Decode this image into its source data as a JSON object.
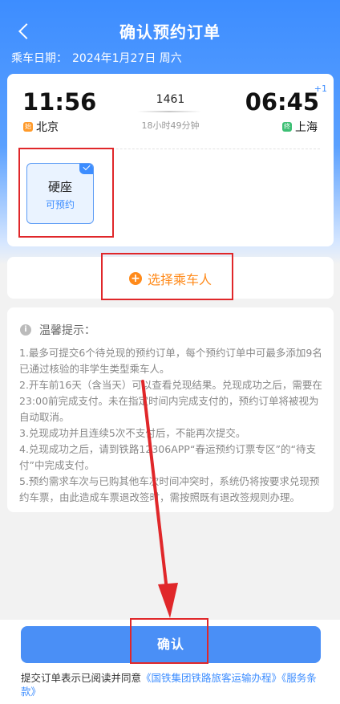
{
  "header": {
    "title": "确认预约订单",
    "date_label": "乘车日期：",
    "date_value": "2024年1月27日 周六"
  },
  "trip": {
    "departure_time": "11:56",
    "departure_station": "北京",
    "departure_badge": "始",
    "train_number": "1461",
    "duration": "18小时49分钟",
    "arrival_time": "06:45",
    "arrival_day_offset": "+1",
    "arrival_station": "上海",
    "arrival_badge": "终"
  },
  "seat": {
    "name": "硬座",
    "status": "可预约"
  },
  "passenger": {
    "select_label": "选择乘车人"
  },
  "tips": {
    "title": "温馨提示：",
    "lines": [
      "1.最多可提交6个待兑现的预约订单，每个预约订单中可最多添加9名已通过核验的非学生类型乘车人。",
      "2.开车前16天（含当天）可以查看兑现结果。兑现成功之后，需要在23:00前完成支付。未在指定时间内完成支付的，预约订单将被视为自动取消。",
      "3.兑现成功并且连续5次不支付后，不能再次提交。",
      "4.兑现成功之后，请到铁路12306APP“春运预约订票专区”的“待支付”中完成支付。",
      "5.预约需求车次与已购其他车次时间冲突时，系统仍将按要求兑现预约车票，由此造成车票退改签时，需按照既有退改签规则办理。"
    ]
  },
  "footer": {
    "confirm_label": "确认",
    "agreement_prefix": "提交订单表示已阅读并同意",
    "agreement_link1": "《国铁集团铁路旅客运输办程》",
    "agreement_link2": "《服务条款》"
  },
  "colors": {
    "primary_blue": "#3d8dff",
    "orange": "#ff8a1a",
    "annotation_red": "#e0272a"
  }
}
